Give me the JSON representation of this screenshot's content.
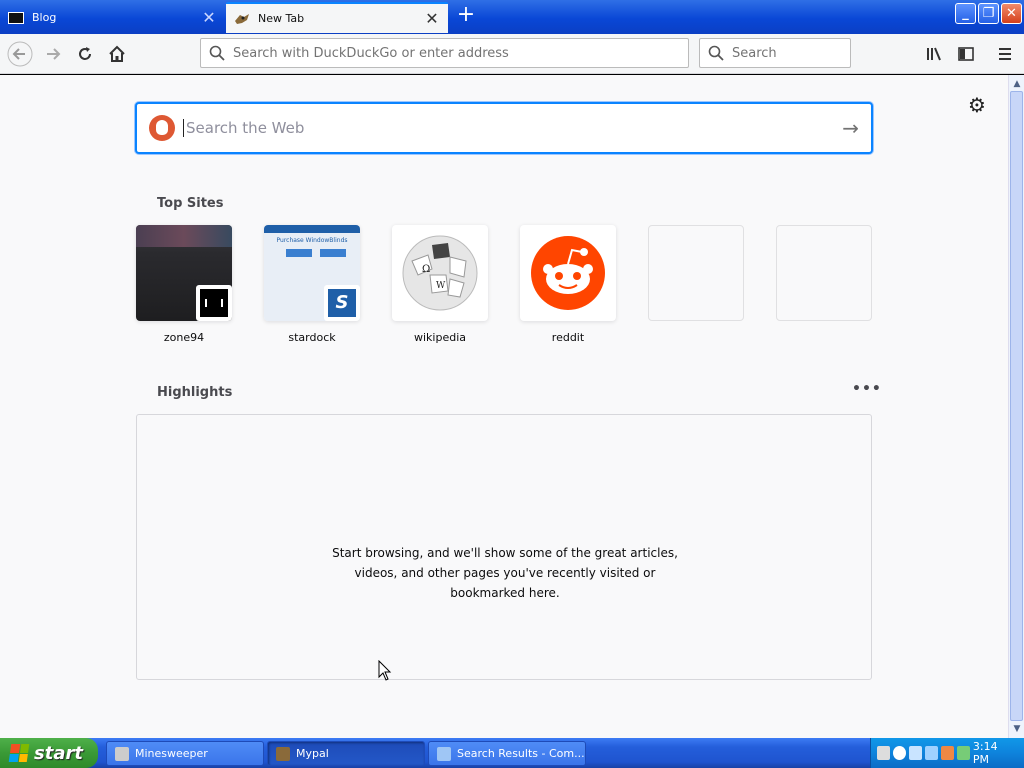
{
  "tabs": [
    {
      "title": "Blog",
      "active": false
    },
    {
      "title": "New Tab",
      "active": true
    }
  ],
  "window_controls": {
    "minimize": "_",
    "restore": "❐",
    "close": "✕"
  },
  "toolbar": {
    "url_placeholder": "Search with DuckDuckGo or enter address",
    "search_placeholder": "Search"
  },
  "newtab": {
    "search_placeholder": "Search the Web",
    "top_sites_heading": "Top Sites",
    "top_sites": [
      {
        "label": "zone94"
      },
      {
        "label": "stardock"
      },
      {
        "label": "wikipedia"
      },
      {
        "label": "reddit"
      },
      {
        "label": ""
      },
      {
        "label": ""
      }
    ],
    "stardock_thumb_text": "Purchase WindowBlinds",
    "highlights_heading": "Highlights",
    "highlights_empty_line1": "Start browsing, and we'll show some of the great articles,",
    "highlights_empty_line2": "videos, and other pages you've recently visited or",
    "highlights_empty_line3": "bookmarked here."
  },
  "taskbar": {
    "start_label": "start",
    "buttons": [
      {
        "label": "Minesweeper"
      },
      {
        "label": "Mypal"
      },
      {
        "label": "Search Results - Com..."
      }
    ],
    "clock": "3:14 PM"
  },
  "colors": {
    "accent": "#0a84ff",
    "reddit": "#ff4500",
    "duckduckgo": "#de5833"
  }
}
